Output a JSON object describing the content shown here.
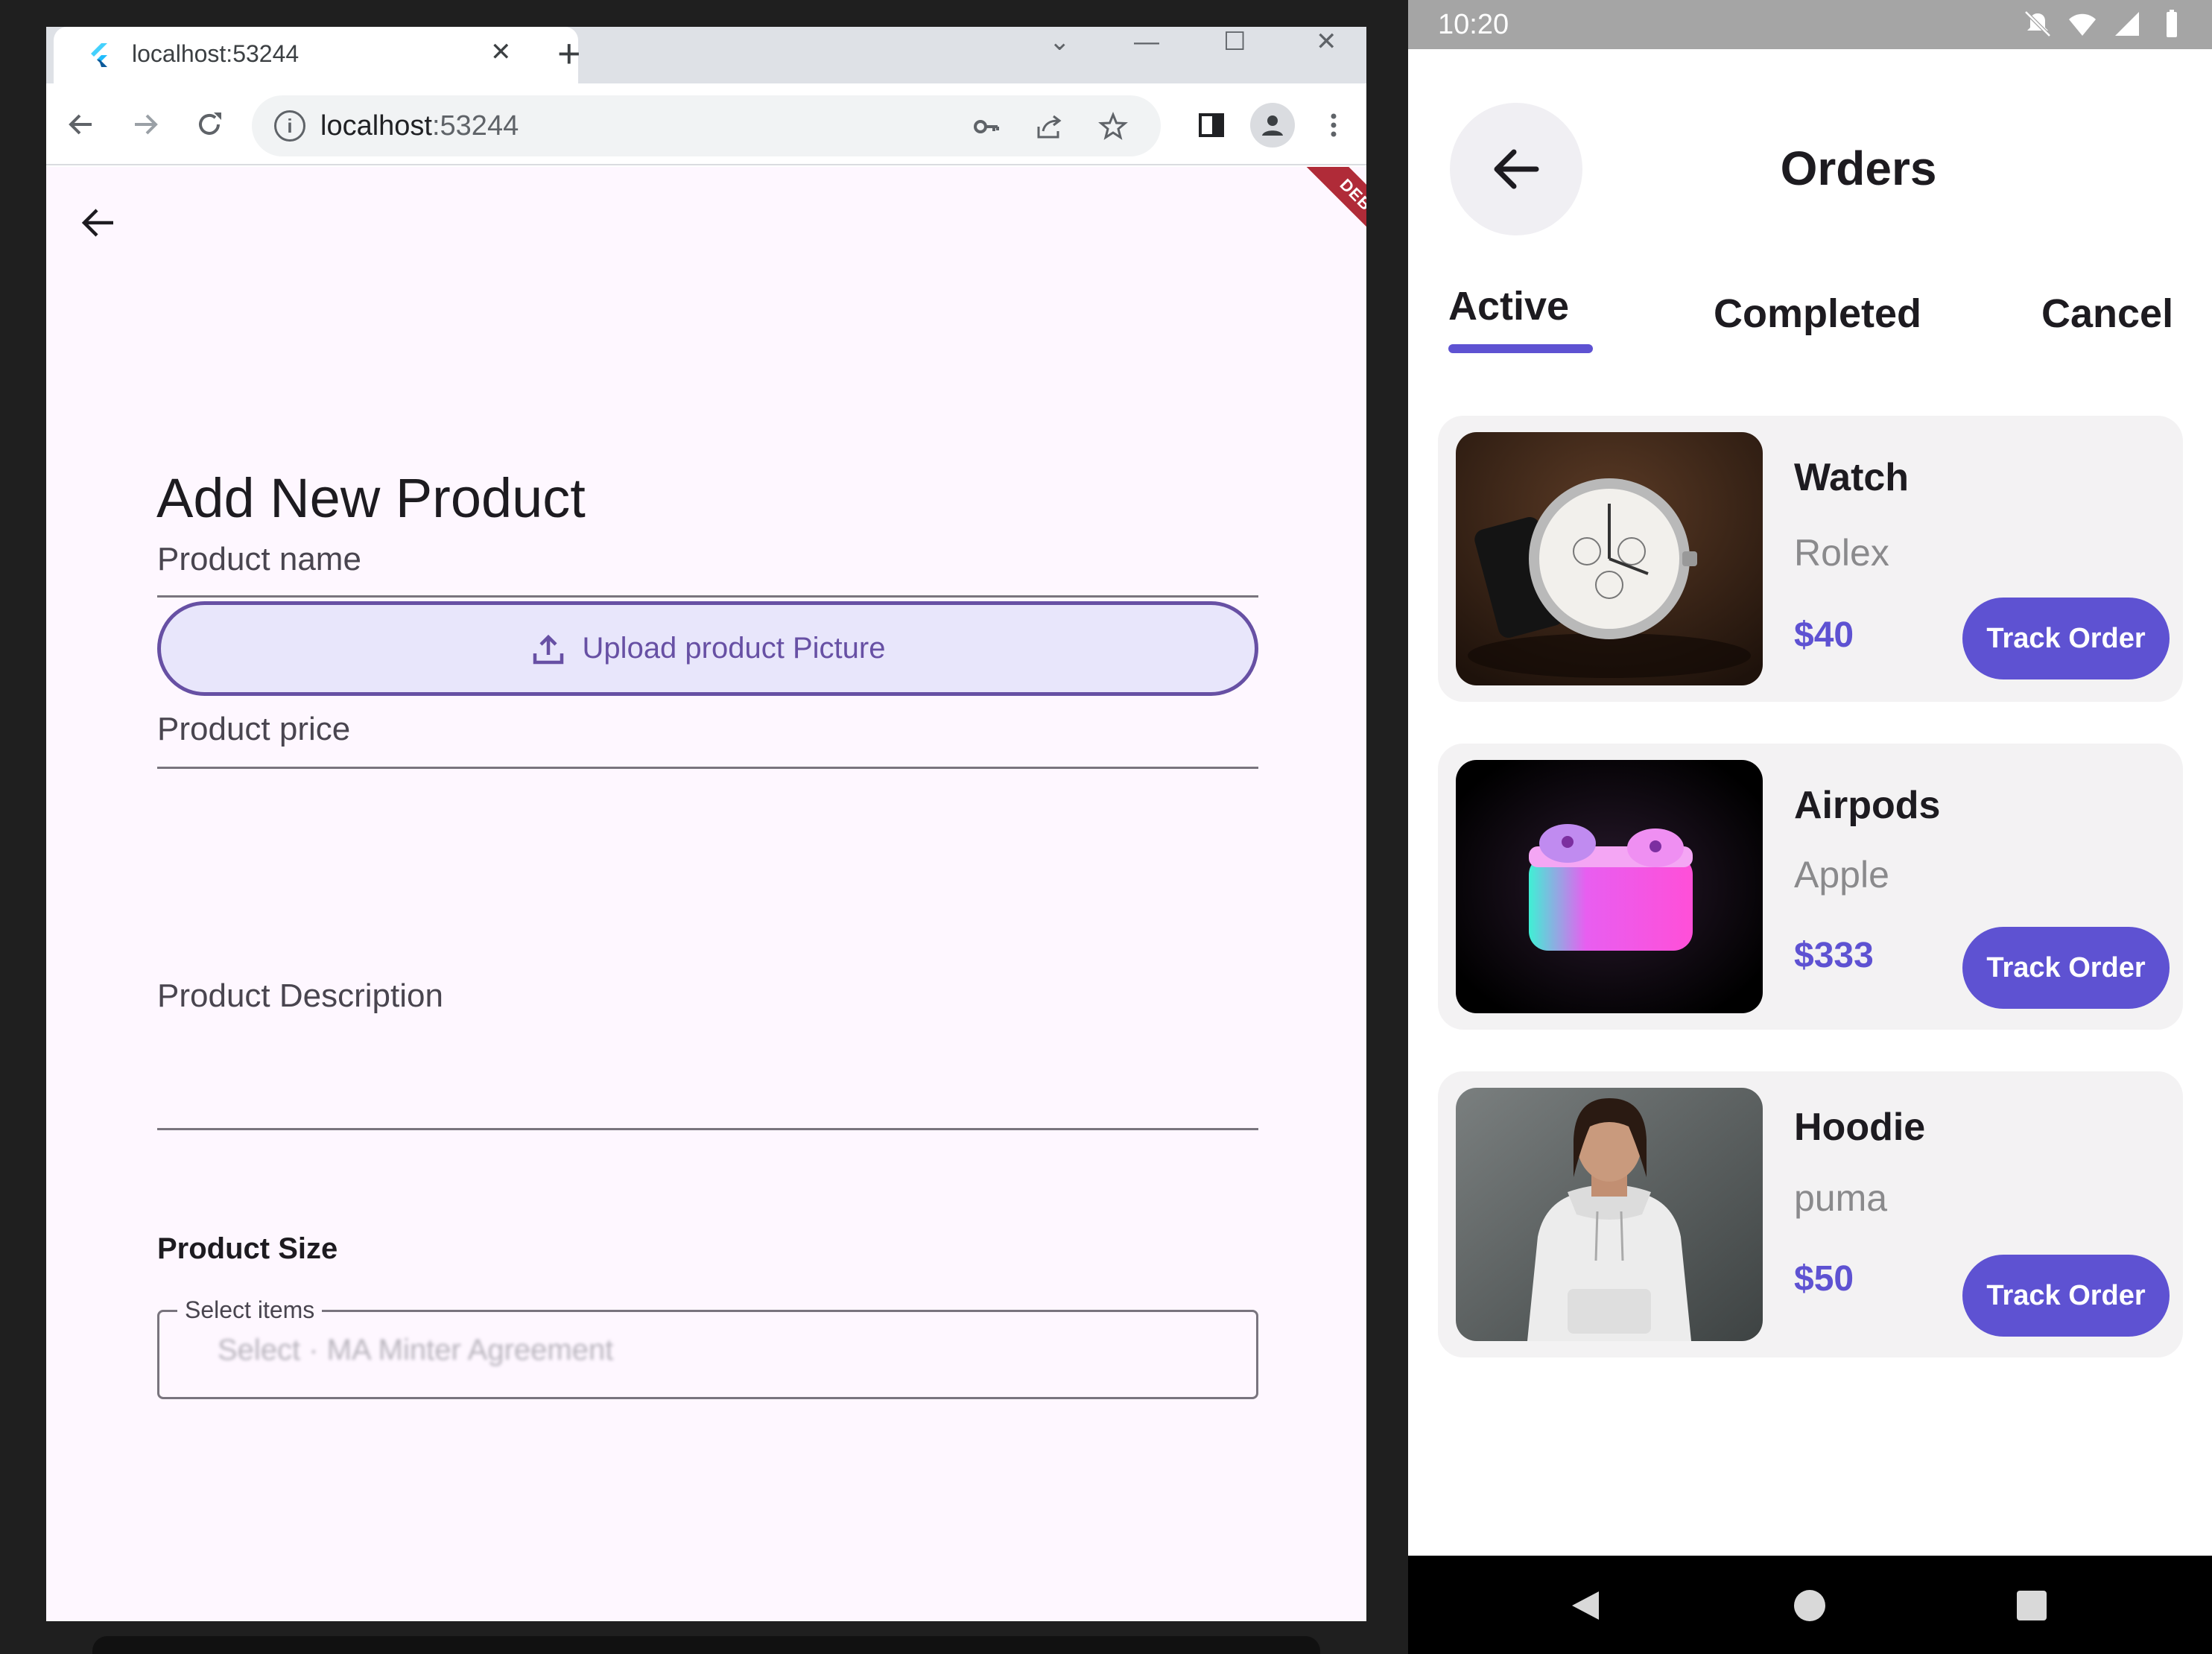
{
  "browser": {
    "tab": {
      "title": "localhost:53244",
      "close_glyph": "✕"
    },
    "new_tab_glyph": "+",
    "window_controls": [
      "⌄",
      "—",
      "☐",
      "✕"
    ],
    "omnibox": {
      "host": "localhost",
      "port": ":53244"
    },
    "icons": [
      "back-icon",
      "forward-icon",
      "reload-icon",
      "info-icon",
      "key-icon",
      "share-icon",
      "star-icon",
      "sidepanel-icon",
      "profile-icon",
      "more-icon"
    ]
  },
  "add_product": {
    "debug_banner": "DEBUG",
    "title": "Add New Product",
    "upload_label": "Upload product Picture",
    "fields": {
      "name": "Product name",
      "price": "Product price",
      "description": "Product Description"
    },
    "size_label": "Product Size",
    "select_legend": "Select items",
    "select_hint": "Select · MA    Minter Agreement"
  },
  "phone": {
    "status_time": "10:20",
    "title": "Orders",
    "tabs": [
      "Active",
      "Completed",
      "Cancel"
    ],
    "active_tab": "Active",
    "accent": "#5e52d2",
    "orders": [
      {
        "name": "Watch",
        "brand": "Rolex",
        "price": "$40",
        "button": "Track Order"
      },
      {
        "name": "Airpods",
        "brand": "Apple",
        "price": "$333",
        "button": "Track Order"
      },
      {
        "name": "Hoodie",
        "brand": "puma",
        "price": "$50",
        "button": "Track Order"
      }
    ]
  }
}
